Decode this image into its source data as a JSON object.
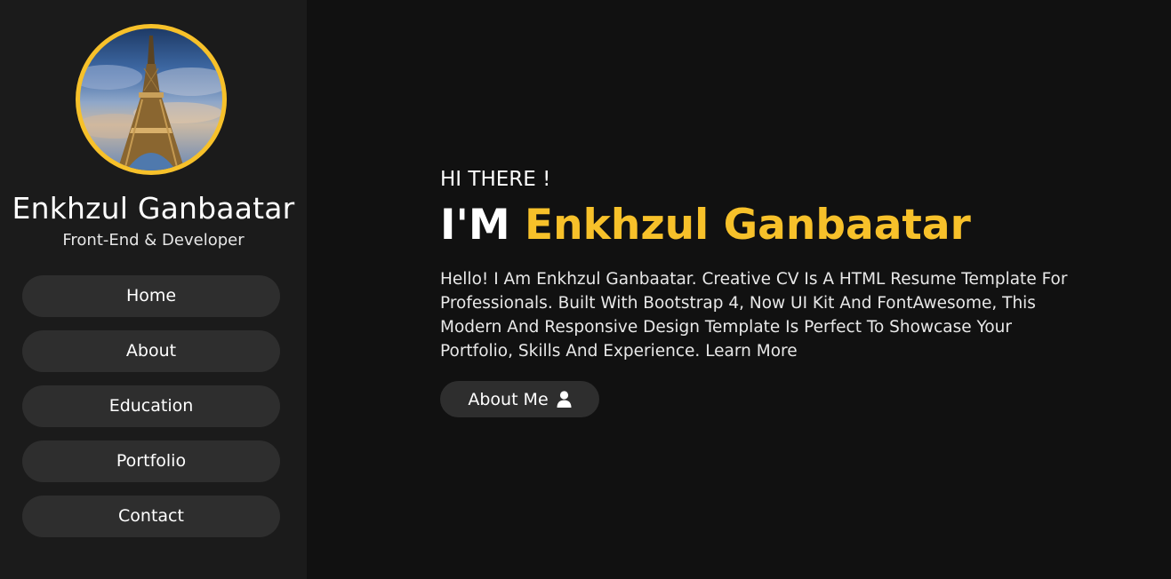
{
  "profile": {
    "name": "Enkhzul Ganbaatar",
    "role": "Front-End & Developer",
    "avatar_border_color": "#f7c12a"
  },
  "nav": {
    "items": [
      {
        "label": "Home"
      },
      {
        "label": "About"
      },
      {
        "label": "Education"
      },
      {
        "label": "Portfolio"
      },
      {
        "label": "Contact"
      }
    ]
  },
  "hero": {
    "greeting": "HI THERE !",
    "headline_prefix": "I'M",
    "headline_name": "Enkhzul Ganbaatar",
    "intro": "Hello! I Am Enkhzul Ganbaatar. Creative CV Is A HTML Resume Template For Professionals. Built With Bootstrap 4, Now UI Kit And FontAwesome, This Modern And Responsive Design Template Is Perfect To Showcase Your Portfolio, Skills And Experience. Learn More",
    "cta_label": "About Me",
    "cta_icon": "user-icon"
  },
  "colors": {
    "accent": "#f7c12a",
    "background": "#111111",
    "sidebar": "#1b1b1b",
    "button": "#2e2e2e"
  }
}
